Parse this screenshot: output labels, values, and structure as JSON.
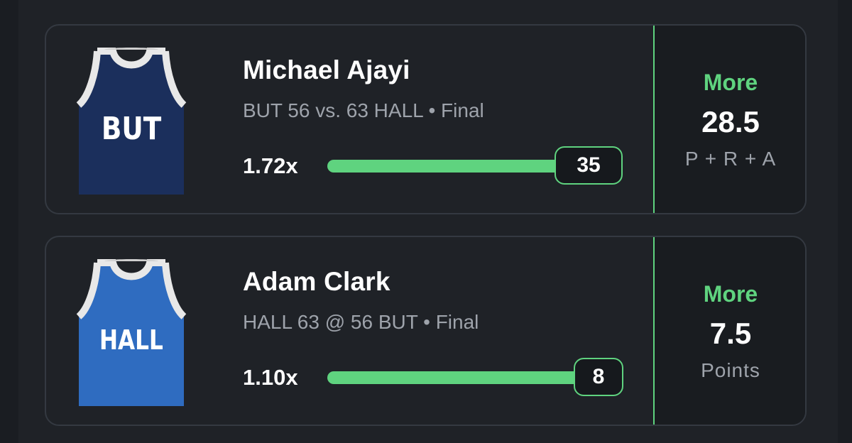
{
  "picks": [
    {
      "team": "BUT",
      "jersey_color": "#1b2f5c",
      "player_name": "Michael Ajayi",
      "game_line": "BUT 56 vs. 63 HALL • Final",
      "multiplier": "1.72x",
      "result": "35",
      "progress_fraction": 1.0,
      "direction": "More",
      "line": "28.5",
      "stat": "P + R + A"
    },
    {
      "team": "HALL",
      "jersey_color": "#2f6cc0",
      "player_name": "Adam Clark",
      "game_line": "HALL 63 @ 56 BUT • Final",
      "multiplier": "1.10x",
      "result": "8",
      "progress_fraction": 1.0,
      "direction": "More",
      "line": "7.5",
      "stat": "Points"
    }
  ],
  "colors": {
    "accent_green": "#5fd37f",
    "background": "#1f2227",
    "muted_text": "#9ea3ab"
  }
}
